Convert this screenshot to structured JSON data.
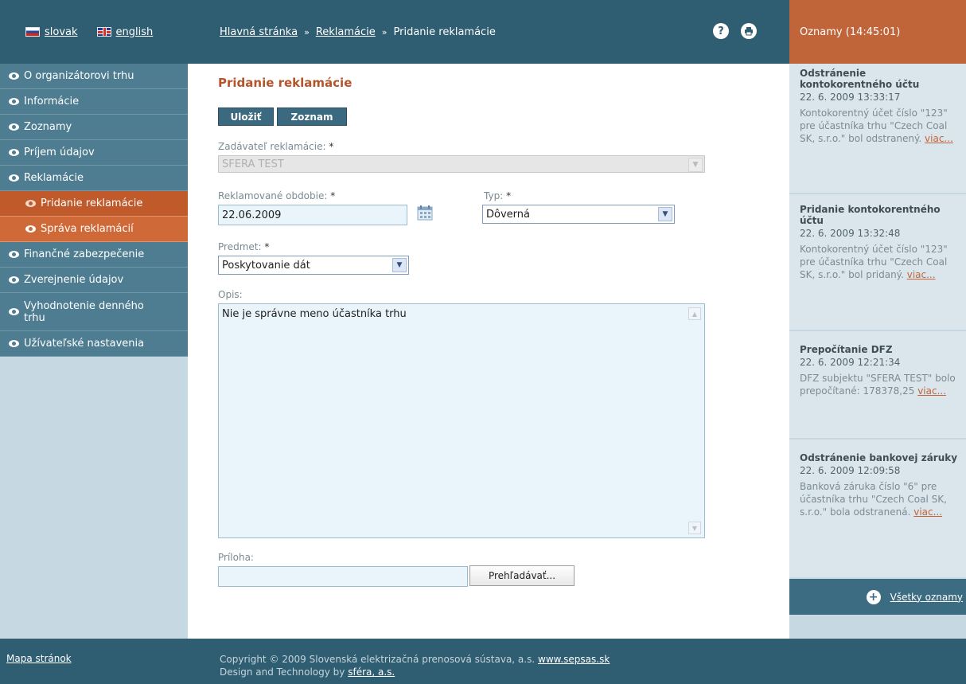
{
  "header": {
    "languages": [
      {
        "label": "slovak",
        "icon": "flag-slovakia-icon"
      },
      {
        "label": "english",
        "icon": "flag-uk-icon"
      }
    ],
    "breadcrumb": {
      "home": "Hlavná stránka",
      "section": "Reklamácie",
      "current": "Pridanie reklamácie",
      "separator": "»"
    },
    "help_icon": "?",
    "print_icon": "⎙"
  },
  "sidebar": {
    "items": [
      {
        "label": "O organizátorovi trhu"
      },
      {
        "label": "Informácie"
      },
      {
        "label": "Zoznamy"
      },
      {
        "label": "Príjem údajov"
      },
      {
        "label": "Reklamácie"
      },
      {
        "label": "Pridanie reklamácie"
      },
      {
        "label": "Správa reklamácií"
      },
      {
        "label": "Finančné zabezpečenie"
      },
      {
        "label": "Zverejnenie údajov"
      },
      {
        "label": "Vyhodnotenie denného trhu"
      },
      {
        "label": "Užívateľské nastavenia"
      }
    ]
  },
  "main": {
    "title": "Pridanie reklamácie",
    "buttons": {
      "save": "Uložiť",
      "list": "Zoznam"
    },
    "form": {
      "submitter_label": "Zadávateľ reklamácie:",
      "submitter_value": "SFERA TEST",
      "period_label": "Reklamované obdobie:",
      "period_value": "22.06.2009",
      "type_label": "Typ:",
      "type_value": "Dôverná",
      "subject_label": "Predmet:",
      "subject_value": "Poskytovanie dát",
      "description_label": "Opis:",
      "description_value": "Nie je správne meno účastníka trhu",
      "attachment_label": "Príloha:",
      "attachment_value": "",
      "browse_label": "Prehľadávať...",
      "required_mark": "*"
    }
  },
  "news": {
    "header": "Oznamy (14:45:01)",
    "more_label": "viac...",
    "items": [
      {
        "title": "Odstránenie kontokorentného účtu",
        "date": "22. 6. 2009 13:33:17",
        "text": "Kontokorentný účet číslo \"123\" pre účastníka trhu \"Czech Coal SK, s.r.o.\" bol odstranený."
      },
      {
        "title": "Pridanie kontokorentného účtu",
        "date": "22. 6. 2009 13:32:48",
        "text": "Kontokorentný účet číslo \"123\" pre účastníka trhu \"Czech Coal SK, s.r.o.\" bol pridaný."
      },
      {
        "title": "Prepočítanie DFZ",
        "date": "22. 6. 2009 12:21:34",
        "text": "DFZ subjektu \"SFERA TEST\" bolo prepočítané: 178378,25"
      },
      {
        "title": "Odstránenie bankovej záruky",
        "date": "22. 6. 2009 12:09:58",
        "text": "Banková záruka číslo \"6\" pre účastníka trhu \"Czech Coal SK, s.r.o.\" bola odstranená."
      }
    ],
    "all_label": "Všetky oznamy"
  },
  "footer": {
    "sitemap": "Mapa stránok",
    "copyright": "Copyright © 2009 Slovenská elektrizačná prenosová sústava, a.s.",
    "site_link": "www.sepsas.sk",
    "design": "Design and Technology by",
    "design_link": "sféra, a.s."
  }
}
